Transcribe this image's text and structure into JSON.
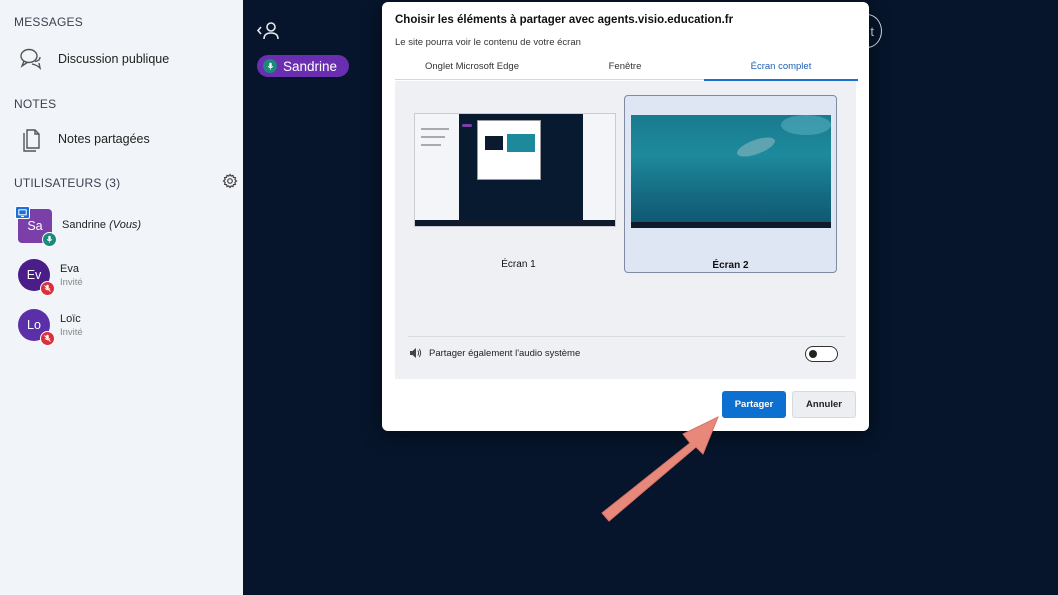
{
  "sidebar": {
    "messages_title": "MESSAGES",
    "public_chat_label": "Discussion publique",
    "notes_title": "NOTES",
    "shared_notes_label": "Notes partagées",
    "users_title": "UTILISATEURS (3)",
    "users": [
      {
        "initials": "Sa",
        "name": "Sandrine",
        "suffix": "(Vous)",
        "role": "",
        "avatar_color": "#7b3fa9",
        "mic": "on",
        "presenter": true
      },
      {
        "initials": "Ev",
        "name": "Eva",
        "suffix": "",
        "role": "Invité",
        "avatar_color": "#4a1d88",
        "mic": "muted",
        "presenter": false
      },
      {
        "initials": "Lo",
        "name": "Loïc",
        "suffix": "",
        "role": "Invité",
        "avatar_color": "#5a2fa8",
        "mic": "muted",
        "presenter": false
      }
    ]
  },
  "main": {
    "speaker_name": "Sandrine",
    "corner_button_glyph": "t"
  },
  "dialog": {
    "title": "Choisir les éléments à partager avec agents.visio.education.fr",
    "subtitle": "Le site pourra voir le contenu de votre écran",
    "tabs": [
      "Onglet Microsoft Edge",
      "Fenêtre",
      "Écran complet"
    ],
    "active_tab": "Écran complet",
    "screens": [
      {
        "label": "Écran 1",
        "selected": false
      },
      {
        "label": "Écran 2",
        "selected": true
      }
    ],
    "audio_label": "Partager également l'audio système",
    "audio_enabled": false,
    "share_button": "Partager",
    "cancel_button": "Annuler"
  },
  "colors": {
    "accent": "#0d6fcf",
    "background": "#06152b",
    "arrow": "#e8887a"
  }
}
